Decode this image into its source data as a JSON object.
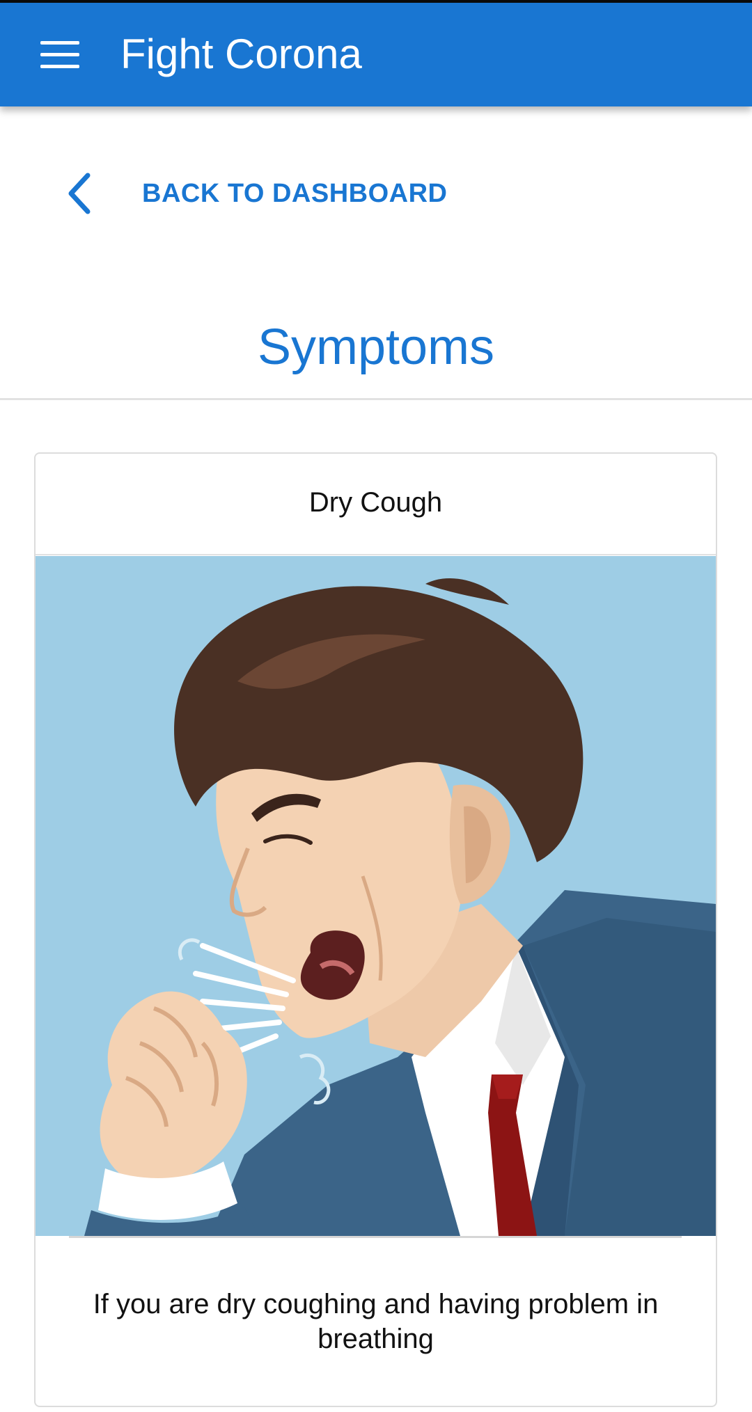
{
  "app": {
    "title": "Fight Corona",
    "menu_icon": "hamburger-menu-icon",
    "accent_color": "#1976d2"
  },
  "nav": {
    "back_label": "BACK TO DASHBOARD",
    "back_icon": "chevron-left-icon"
  },
  "page": {
    "title": "Symptoms"
  },
  "card": {
    "title": "Dry Cough",
    "image_subject": "coughing-man-illustration",
    "description": "If you are dry coughing and having problem in breathing"
  }
}
